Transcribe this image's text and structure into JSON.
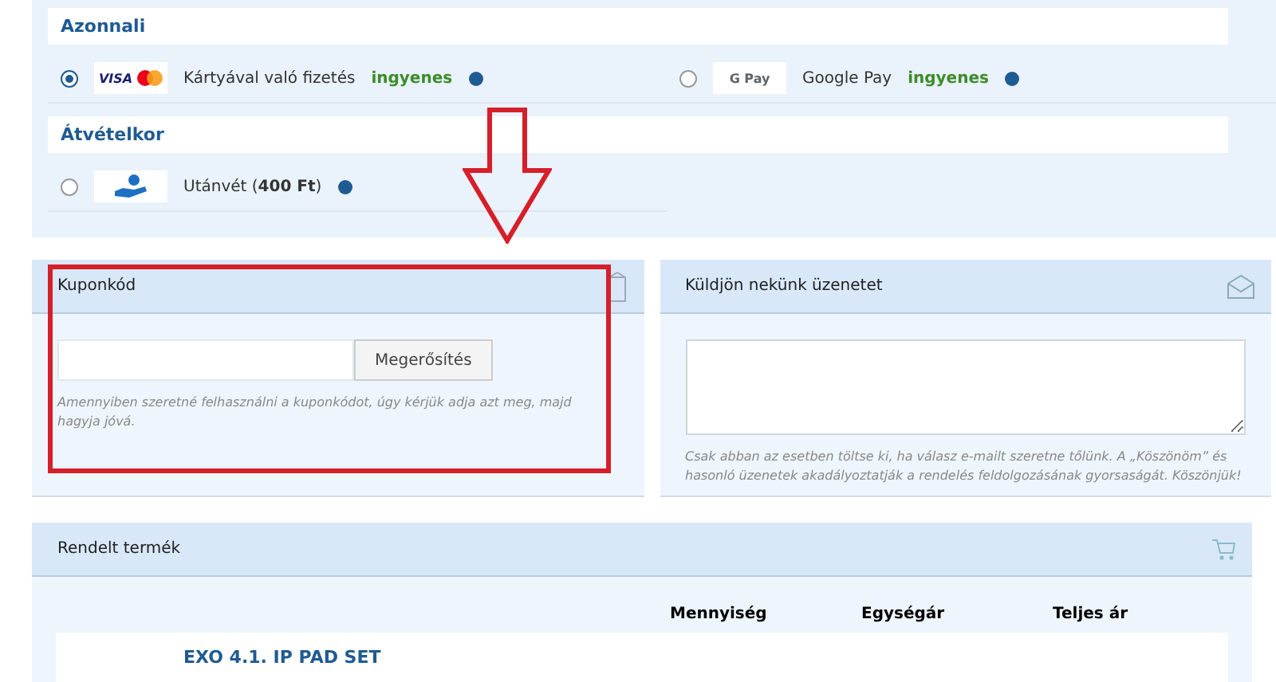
{
  "payment_groups": [
    {
      "title": "Azonnali",
      "options": [
        {
          "kind": "card",
          "logo_text": "VISA",
          "label": "Kártyával való fizetés",
          "price": "ingyenes",
          "selected": true
        },
        {
          "kind": "gpay",
          "logo_text": "G Pay",
          "label": "Google Pay",
          "price": "ingyenes",
          "selected": false
        }
      ]
    },
    {
      "title": "Átvételkor",
      "options": [
        {
          "kind": "cash",
          "label": "Utánvét (**400 Ft**)",
          "selected": false
        }
      ]
    }
  ],
  "coupon": {
    "title": "Kuponkód",
    "button": "Megerősítés",
    "hint": "Amennyiben szeretné felhasználni a kuponkódot, úgy kérjük adja azt meg, majd hagyja jóvá."
  },
  "message": {
    "title": "Küldjön nekünk üzenetet",
    "hint": "Csak abban az esetben töltse ki, ha válasz e-mailt szeretne tőlünk. A „Köszönöm” és hasonló üzenetek akadályoztatják a rendelés feldolgozásának gyorsaságát. Köszönjük!"
  },
  "order": {
    "title": "Rendelt termék",
    "columns": [
      "Mennyiség",
      "Egységár",
      "Teljes ár"
    ],
    "products": [
      {
        "name": "EXO 4.1. IP PAD SET"
      }
    ]
  }
}
